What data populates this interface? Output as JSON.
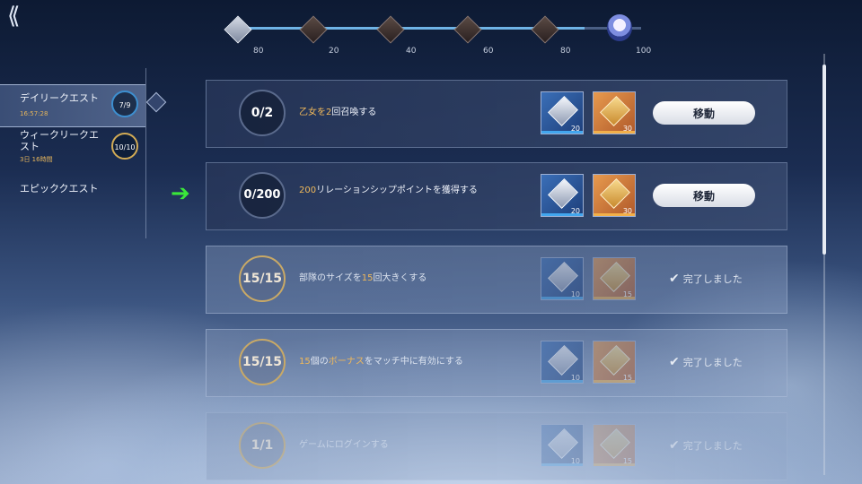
{
  "header": {
    "back_icon": "back-arrow-icon",
    "milestones": [
      {
        "label": "80",
        "state": "claimed"
      },
      {
        "label": "20",
        "state": "locked"
      },
      {
        "label": "40",
        "state": "locked"
      },
      {
        "label": "60",
        "state": "locked"
      },
      {
        "label": "80",
        "state": "locked"
      },
      {
        "label": "100",
        "state": "final"
      }
    ],
    "progress_fraction": 0.86
  },
  "sidebar": {
    "tabs": [
      {
        "title": "デイリークエスト",
        "sub": "16:57:28",
        "count": "7/9",
        "ring": "blue",
        "active": true
      },
      {
        "title": "ウィークリークエスト",
        "sub": "3日 16時間",
        "count": "10/10",
        "ring": "gold",
        "active": false
      },
      {
        "title": "エピッククエスト",
        "sub": "",
        "count": "",
        "ring": "",
        "active": false
      }
    ]
  },
  "quests": [
    {
      "progress": "0/2",
      "desc_pre": "",
      "desc_hl1": "乙女を",
      "desc_mid": "",
      "desc_hl2": "2",
      "desc_post": "回召喚する",
      "reward_silver": "20",
      "reward_gold": "30",
      "action": "移動",
      "done": false
    },
    {
      "progress": "0/200",
      "desc_pre": "",
      "desc_hl1": "200",
      "desc_mid": "リレーションシップポイントを獲得する",
      "desc_hl2": "",
      "desc_post": "",
      "reward_silver": "20",
      "reward_gold": "30",
      "action": "移動",
      "done": false
    },
    {
      "progress": "15/15",
      "desc_pre": "部隊のサイズを",
      "desc_hl1": "15",
      "desc_mid": "回大きくする",
      "desc_hl2": "",
      "desc_post": "",
      "reward_silver": "10",
      "reward_gold": "15",
      "action": "完了しました",
      "done": true
    },
    {
      "progress": "15/15",
      "desc_pre": "",
      "desc_hl1": "15",
      "desc_mid": "個の",
      "desc_hl2": "ボーナス",
      "desc_post": "をマッチ中に有効にする",
      "reward_silver": "10",
      "reward_gold": "15",
      "action": "完了しました",
      "done": true
    },
    {
      "progress": "1/1",
      "desc_pre": "ゲームにログインする",
      "desc_hl1": "",
      "desc_mid": "",
      "desc_hl2": "",
      "desc_post": "",
      "reward_silver": "10",
      "reward_gold": "15",
      "action": "完了しました",
      "done": true
    }
  ],
  "colors": {
    "accent_gold": "#f0b85a",
    "progress_blue": "#6fb3e6",
    "arrow_green": "#3ae83a"
  }
}
